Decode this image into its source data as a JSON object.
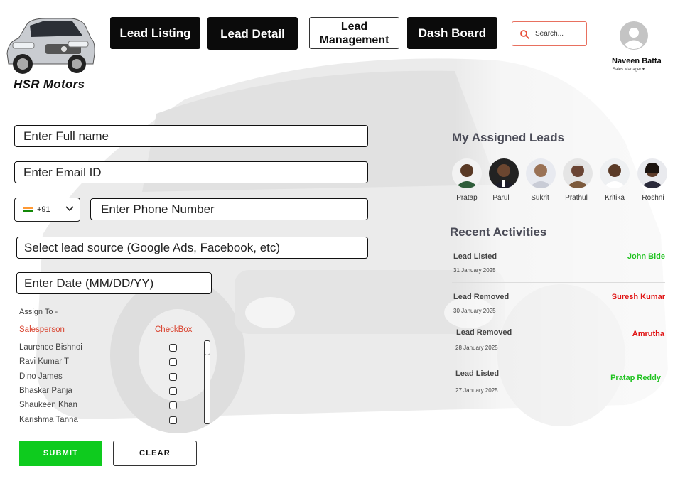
{
  "brand": {
    "name": "HSR Motors"
  },
  "nav": {
    "lead_listing": "Lead Listing",
    "lead_detail": "Lead Detail",
    "lead_management": "Lead Management",
    "dashboard": "Dash Board"
  },
  "search": {
    "placeholder": "Search..."
  },
  "profile": {
    "name": "Naveen Batta",
    "role": "Sales Manager ▾"
  },
  "form": {
    "full_name_placeholder": "Enter Full name",
    "email_placeholder": "Enter Email ID",
    "country_code": "+91",
    "phone_placeholder": "Enter Phone Number",
    "lead_source_placeholder": "Select lead source (Google Ads, Facebook, etc)",
    "date_placeholder": "Enter Date (MM/DD/YY)"
  },
  "assign": {
    "label": "Assign To -",
    "col_salesperson": "Salesperson",
    "col_checkbox": "CheckBox",
    "salespeople": [
      "Laurence Bishnoi",
      "Ravi Kumar T",
      "Dino  James",
      "Bhaskar Panja",
      "Shaukeen Khan",
      "Karishma Tanna"
    ]
  },
  "actions": {
    "submit": "SUBMIT",
    "clear": "CLEAR"
  },
  "assigned_leads": {
    "title": "My Assigned Leads",
    "leads": [
      "Pratap",
      "Parul",
      "Sukrit",
      "Prathul",
      "Kritika",
      "Roshni"
    ]
  },
  "recent_activities": {
    "title": "Recent Activities",
    "items": [
      {
        "action": "Lead Listed",
        "date": "31 January 2025",
        "person": "John Bide",
        "color": "#1fc21f"
      },
      {
        "action": "Lead Removed",
        "date": "30 January 2025",
        "person": "Suresh Kumar",
        "color": "#e01414"
      },
      {
        "action": "Lead Removed",
        "date": "28 January 2025",
        "person": "Amrutha",
        "color": "#e01414"
      },
      {
        "action": "Lead Listed",
        "date": "27 January 2025",
        "person": "Pratap Reddy",
        "color": "#1fc21f"
      }
    ]
  },
  "colors": {
    "accent_red": "#d9432f",
    "submit_green": "#0ecb1e",
    "nav_dark": "#0b0b0b"
  }
}
